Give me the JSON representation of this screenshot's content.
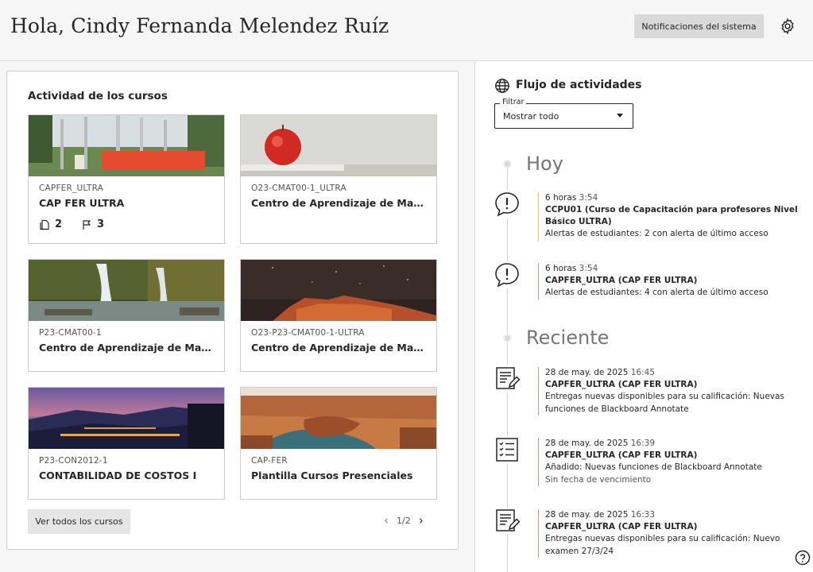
{
  "header": {
    "greeting": "Hola, Cindy Fernanda Melendez Ruíz",
    "system_notifications": "Notificaciones del sistema"
  },
  "courses": {
    "title": "Actividad de los cursos",
    "items": [
      {
        "code": "CAPFER_ULTRA",
        "name": "CAP FER ULTRA",
        "stat_files": "2",
        "stat_flags": "3"
      },
      {
        "code": "O23-CMAT00-1_ULTRA",
        "name": "Centro de Aprendizaje de Matemática"
      },
      {
        "code": "P23-CMAT00-1",
        "name": "Centro de Aprendizaje de Matemática"
      },
      {
        "code": "O23-P23-CMAT00-1-ULTRA",
        "name": "Centro de Aprendizaje de Matemática"
      },
      {
        "code": "P23-CON2012-1",
        "name": "CONTABILIDAD DE COSTOS I"
      },
      {
        "code": "CAP-FER",
        "name": "Plantilla Cursos Presenciales"
      }
    ],
    "view_all": "Ver todos los cursos",
    "pager": "1/2"
  },
  "stream": {
    "title": "Flujo de actividades",
    "filter_label": "Filtrar",
    "filter_value": "Mostrar todo",
    "today_label": "Hoy",
    "recent_label": "Reciente",
    "today": [
      {
        "time_prefix": "6 horas",
        "time": "3:54",
        "course": "CCPU01 (Curso de Capacitación para profesores Nivel Básico ULTRA)",
        "desc": "Alertas de estudiantes: 2 con alerta de último acceso"
      },
      {
        "time_prefix": "6 horas",
        "time": "3:54",
        "course": "CAPFER_ULTRA (CAP FER ULTRA)",
        "desc": "Alertas de estudiantes: 4 con alerta de último acceso"
      }
    ],
    "recent": [
      {
        "date": "28 de may. de 2025",
        "time": "16:45",
        "course": "CAPFER_ULTRA (CAP FER ULTRA)",
        "desc": "Entregas nuevas disponibles para su calificación: Nuevas funciones de Blackboard Annotate"
      },
      {
        "date": "28 de may. de 2025",
        "time": "16:39",
        "course": "CAPFER_ULTRA (CAP FER ULTRA)",
        "desc": "Añadido: Nuevas funciones de Blackboard Annotate",
        "sub": "Sin fecha de vencimiento"
      },
      {
        "date": "28 de may. de 2025",
        "time": "16:33",
        "course": "CAPFER_ULTRA (CAP FER ULTRA)",
        "desc": "Entregas nuevas disponibles para su calificación: Nuevo examen 27/3/24"
      }
    ]
  }
}
